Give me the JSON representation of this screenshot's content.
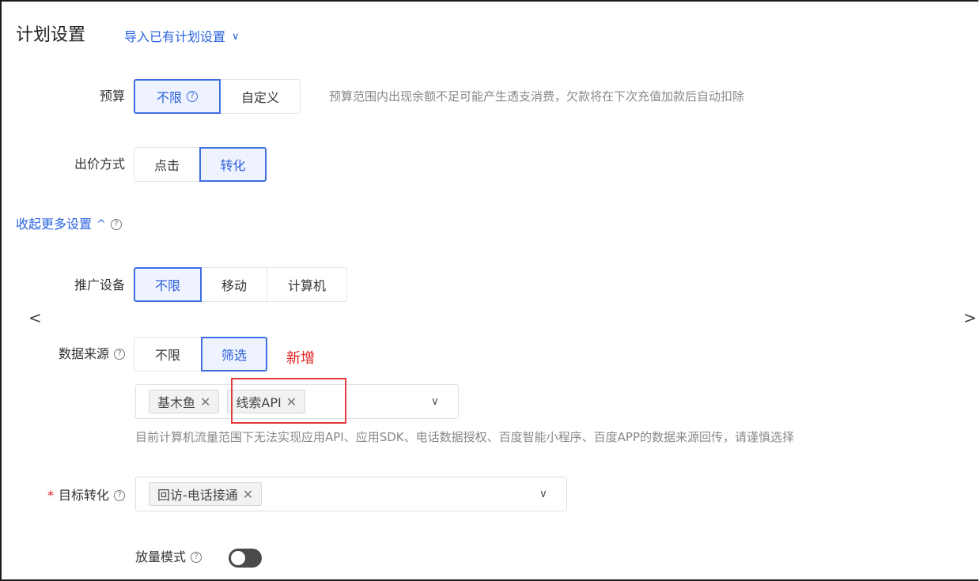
{
  "header": {
    "title": "计划设置",
    "import_label": "导入已有计划设置",
    "chevron": "∨"
  },
  "budget": {
    "label": "预算",
    "options": [
      "不限",
      "自定义"
    ],
    "selected": "不限",
    "hint": "预算范围内出现余额不足可能产生透支消费，欠款将在下次充值加款后自动扣除"
  },
  "bid": {
    "label": "出价方式",
    "options": [
      "点击",
      "转化"
    ],
    "selected": "转化"
  },
  "collapse_label": "收起更多设置",
  "collapse_caret": "^",
  "device": {
    "label": "推广设备",
    "options": [
      "不限",
      "移动",
      "计算机"
    ],
    "selected": "不限"
  },
  "nav": {
    "left": "<",
    "right": ">"
  },
  "data_source": {
    "label": "数据来源",
    "options": [
      "不限",
      "筛选"
    ],
    "selected": "筛选",
    "new_tag": "新增",
    "chips": [
      "基木鱼",
      "线索API"
    ],
    "hint": "目前计算机流量范围下无法实现应用API、应用SDK、电话数据授权、百度智能小程序、百度APP的数据来源回传，请谨慎选择"
  },
  "target": {
    "required_mark": "*",
    "label": "目标转化",
    "chips": [
      "回访-电话接通"
    ]
  },
  "amplify": {
    "label": "放量模式",
    "enabled": false
  },
  "icons": {
    "help": "?",
    "close": "✕",
    "dropdown": "∨"
  },
  "colors": {
    "accent": "#2b64e0",
    "active_bg": "#eef3ff",
    "new_red": "#e32020"
  }
}
